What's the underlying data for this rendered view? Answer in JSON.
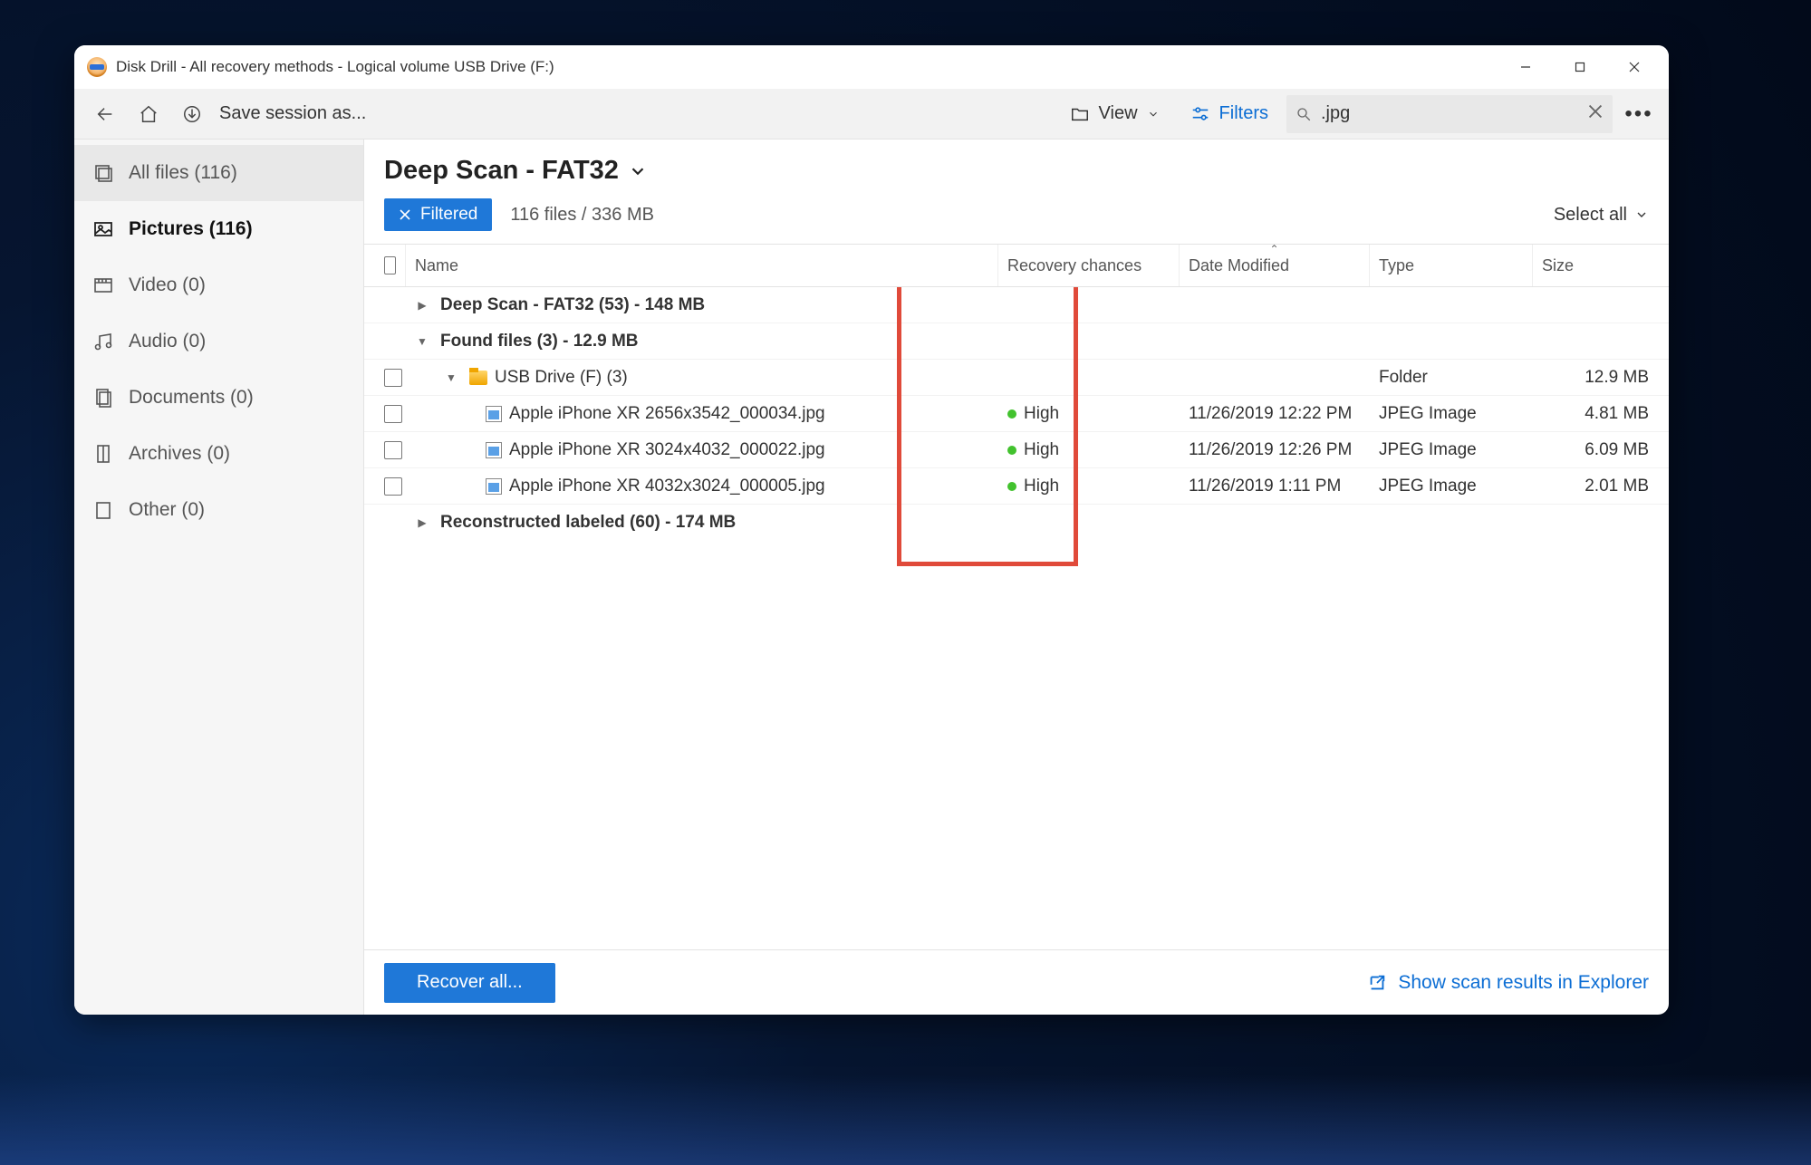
{
  "window_title": "Disk Drill - All recovery methods - Logical volume USB Drive (F:)",
  "toolbar": {
    "save_session": "Save session as...",
    "view_label": "View",
    "filters_label": "Filters",
    "search_value": ".jpg"
  },
  "sidebar": {
    "items": [
      {
        "label": "All files (116)"
      },
      {
        "label": "Pictures (116)"
      },
      {
        "label": "Video (0)"
      },
      {
        "label": "Audio (0)"
      },
      {
        "label": "Documents (0)"
      },
      {
        "label": "Archives (0)"
      },
      {
        "label": "Other (0)"
      }
    ]
  },
  "main": {
    "scan_title": "Deep Scan - FAT32",
    "filtered_label": "Filtered",
    "count_label": "116 files / 336 MB",
    "select_all": "Select all"
  },
  "columns": {
    "name": "Name",
    "recovery": "Recovery chances",
    "modified": "Date Modified",
    "type": "Type",
    "size": "Size"
  },
  "groups": {
    "g1": "Deep Scan - FAT32 (53) - 148 MB",
    "g2": "Found files (3) - 12.9 MB",
    "g2_folder": "USB Drive (F) (3)",
    "g2_folder_type": "Folder",
    "g2_folder_size": "12.9 MB",
    "g3": "Reconstructed labeled (60) - 174 MB"
  },
  "files": [
    {
      "name": "Apple iPhone XR 2656x3542_000034.jpg",
      "chance": "High",
      "date": "11/26/2019 12:22 PM",
      "type": "JPEG Image",
      "size": "4.81 MB"
    },
    {
      "name": "Apple iPhone XR 3024x4032_000022.jpg",
      "chance": "High",
      "date": "11/26/2019 12:26 PM",
      "type": "JPEG Image",
      "size": "6.09 MB"
    },
    {
      "name": "Apple iPhone XR 4032x3024_000005.jpg",
      "chance": "High",
      "date": "11/26/2019 1:11 PM",
      "type": "JPEG Image",
      "size": "2.01 MB"
    }
  ],
  "footer": {
    "recover": "Recover all...",
    "explorer": "Show scan results in Explorer"
  }
}
